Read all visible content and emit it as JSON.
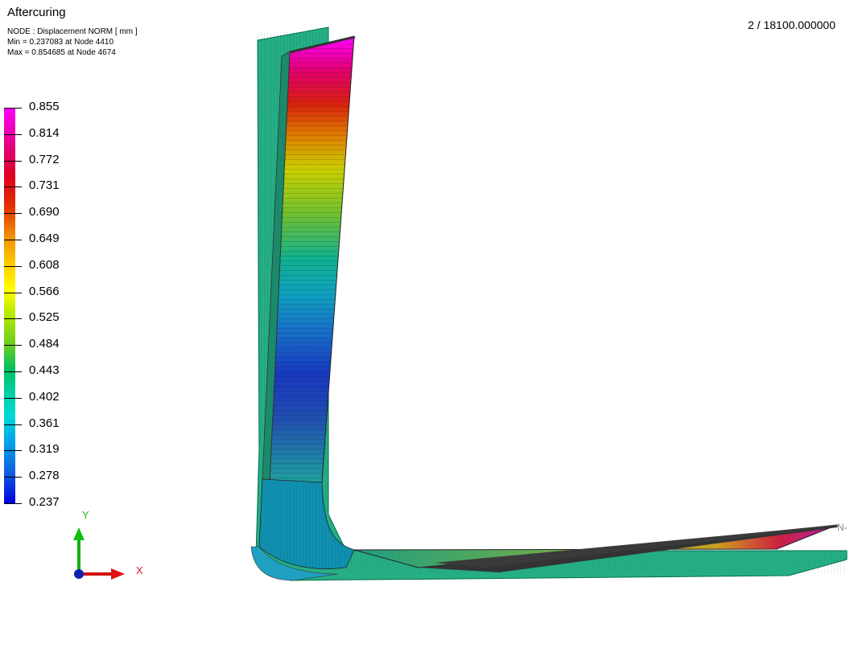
{
  "viewport": {
    "title": "Aftercuring",
    "info_line_1": "NODE : Displacement NORM [ mm ]",
    "info_line_2": "Min = 0.237083 at Node 4410",
    "info_line_3": "Max = 0.854685 at Node 4674",
    "frame_indicator": "2 / 18100.000000"
  },
  "legend": {
    "labels": [
      "0.855",
      "0.814",
      "0.772",
      "0.731",
      "0.690",
      "0.649",
      "0.608",
      "0.566",
      "0.525",
      "0.484",
      "0.443",
      "0.402",
      "0.361",
      "0.319",
      "0.278",
      "0.237"
    ],
    "colormap": [
      "#ff00ff",
      "#e00020",
      "#f08a00",
      "#ffff00",
      "#6acc20",
      "#00c060",
      "#00d8d8",
      "#1060e0",
      "#0000e0"
    ]
  },
  "axes": {
    "x_label": "X",
    "y_label": "Y",
    "x_color": "#e02020",
    "y_color": "#20c020",
    "z_color": "#1020c0"
  },
  "model": {
    "edge_label": "N-",
    "wire_color": "#00a878",
    "shell_color": "#333333"
  }
}
